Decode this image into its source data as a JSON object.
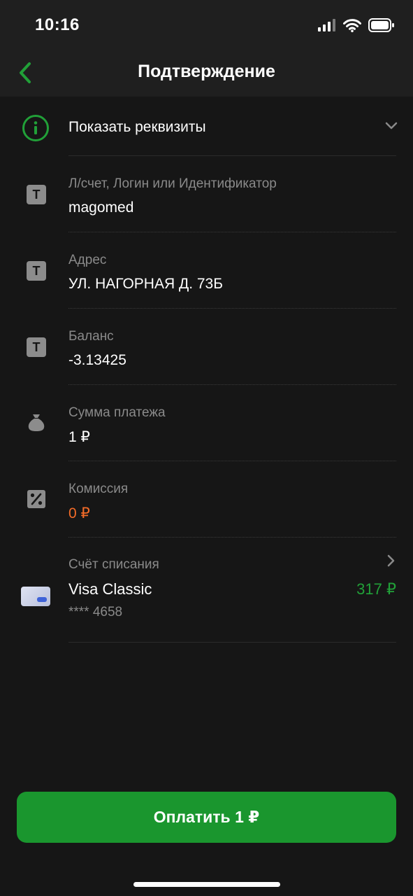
{
  "status_bar": {
    "time": "10:16"
  },
  "header": {
    "title": "Подтверждение"
  },
  "details_toggle": {
    "label": "Показать реквизиты"
  },
  "fields": [
    {
      "label": "Л/счет, Логин или Идентификатор",
      "value": "magomed",
      "icon": "text-field-icon"
    },
    {
      "label": "Адрес",
      "value": "УЛ. НАГОРНАЯ Д. 73Б",
      "icon": "text-field-icon"
    },
    {
      "label": "Баланс",
      "value": "-3.13425",
      "icon": "text-field-icon"
    },
    {
      "label": "Сумма платежа",
      "value": "1 ₽",
      "icon": "money-bag-icon"
    },
    {
      "label": "Комиссия",
      "value": "0 ₽",
      "icon": "percent-icon"
    }
  ],
  "account": {
    "label": "Счёт списания",
    "name": "Visa Classic",
    "number": "**** 4658",
    "balance": "317 ₽"
  },
  "pay_button": {
    "label": "Оплатить 1 ₽"
  },
  "colors": {
    "accent": "#21a038",
    "button": "#1a962e",
    "commission": "#f26b28",
    "background": "#161616"
  }
}
